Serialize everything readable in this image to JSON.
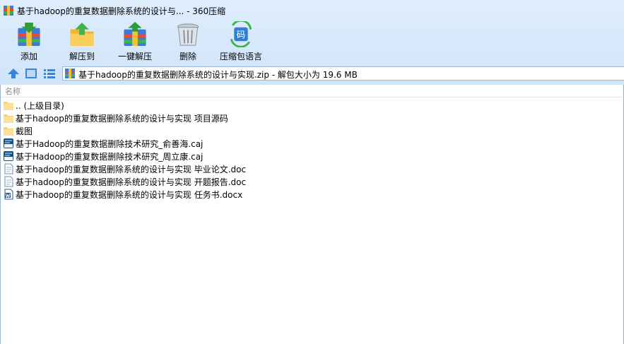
{
  "window": {
    "title": "基于hadoop的重复数据删除系统的设计与... - 360压缩"
  },
  "toolbar": {
    "buttons": [
      {
        "label": "添加",
        "icon": "add-archive-icon"
      },
      {
        "label": "解压到",
        "icon": "extract-to-icon"
      },
      {
        "label": "一键解压",
        "icon": "one-click-extract-icon"
      },
      {
        "label": "删除",
        "icon": "delete-trash-icon"
      },
      {
        "label": "压缩包语言",
        "icon": "archive-language-icon"
      }
    ],
    "language_badge": "码"
  },
  "address": {
    "path": "基于hadoop的重复数据删除系统的设计与实现.zip - 解包大小为 19.6 MB"
  },
  "list": {
    "column_name": "名称",
    "items": [
      {
        "name": ".. (上级目录)",
        "type": "folder"
      },
      {
        "name": "基于hadoop的重复数据删除系统的设计与实现 项目源码",
        "type": "folder"
      },
      {
        "name": "截图",
        "type": "folder"
      },
      {
        "name": "基于Hadoop的重复数据删除技术研究_俞善海.caj",
        "type": "caj"
      },
      {
        "name": "基于Hadoop的重复数据删除技术研究_周立康.caj",
        "type": "caj"
      },
      {
        "name": "基于hadoop的重复数据删除系统的设计与实现 毕业论文.doc",
        "type": "doc"
      },
      {
        "name": "基于hadoop的重复数据删除系统的设计与实现 开题报告.doc",
        "type": "doc"
      },
      {
        "name": "基于hadoop的重复数据删除系统的设计与实现 任务书.docx",
        "type": "docx"
      }
    ]
  },
  "colors": {
    "chrome_bg": "#d6e7fb",
    "border": "#9fb6d1",
    "folder": "#f6d27a"
  }
}
